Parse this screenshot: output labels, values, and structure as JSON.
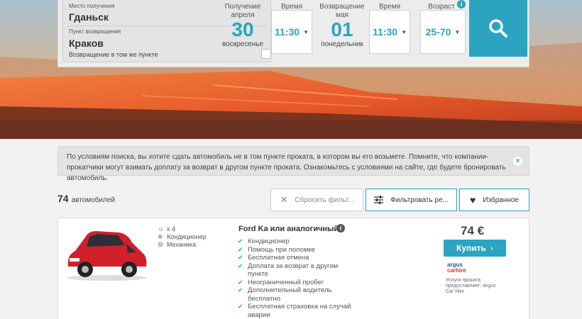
{
  "search": {
    "pickup_label": "Место получения",
    "pickup_value": "Гданьск",
    "return_label": "Пункт возвращения",
    "return_value": "Краков",
    "same_place_label": "Возвращение в том же пункте",
    "pickup_col_label": "Получение",
    "pickup_month": "апреля",
    "pickup_day": "30",
    "pickup_weekday": "воскресенье",
    "time_label_1": "Время",
    "pickup_time": "11:30",
    "return_col_label": "Возвращение",
    "return_month": "мая",
    "return_day": "01",
    "return_weekday": "понедельник",
    "time_label_2": "Время",
    "return_time": "11:30",
    "age_label": "Возраст",
    "age_value": "25-70",
    "info_glyph": "i",
    "search_icon": "magnifier-icon"
  },
  "notice": {
    "text": "По условиям поиска, вы хотите сдать автомобиль не в том пункте проката, в котором вы его возьмете. Помните, что компании-прокатчики могут взимать доплату за возврат в другом пункте проката. Ознакомьтесь с условиями на сайте, где будете бронировать автомобиль.",
    "close_glyph": "×"
  },
  "results": {
    "count": "74",
    "count_label": "автомобилей",
    "reset_label": "Сбросить фильт...",
    "filter_label": "Фильтровать ре...",
    "favorites_label": "Избранное"
  },
  "card": {
    "seats": "x 4",
    "ac": "Кондиционер",
    "transmission": "Механика",
    "title": "Ford Ka или аналогичный",
    "features": [
      "Кондиционер",
      "Помощь при поломке",
      "Бесплатная отмена",
      "Доплата за возврат в другом пункте",
      "Неограниченный пробег",
      "Дополнительный водитель бесплатно",
      "Бесплатная страховка на случай аварии"
    ],
    "price": "74 €",
    "buy_label": "Купить",
    "provider_logo_1": "argus",
    "provider_logo_2": "carhire",
    "provider_text": "Услуги проката предоставляет: Argus Car Hire"
  },
  "colors": {
    "accent": "#2aa4c0",
    "car": "#d0202a"
  }
}
